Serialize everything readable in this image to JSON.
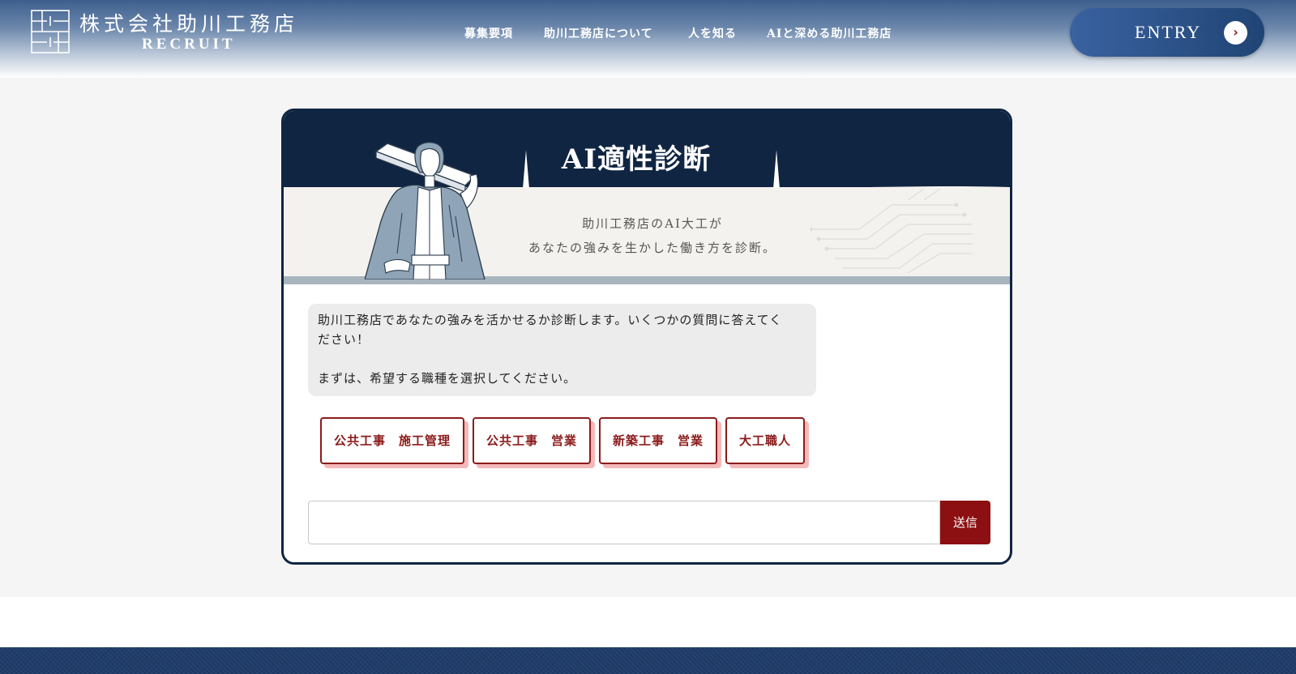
{
  "header": {
    "logo_name": "株式会社助川工務店",
    "logo_sub": "RECRUIT",
    "nav": [
      {
        "label": "募集要項"
      },
      {
        "label": "助川工務店について"
      },
      {
        "label": "人を知る"
      },
      {
        "label": "AIと深める助川工務店"
      }
    ],
    "entry_label": "ENTRY",
    "entry_icon": "chevron-right-icon"
  },
  "banner": {
    "title": "AI適性診断",
    "subtitle_line1": "助川工務店のAI大工が",
    "subtitle_line2": "あなたの強みを生かした働き方を診断。"
  },
  "chat": {
    "message_line1": "助川工務店であなたの強みを活かせるか診断します。いくつかの質問に答えてく",
    "message_line2": "ださい！",
    "message_line3": "まずは、希望する職種を選択してください。",
    "choices": [
      {
        "label": "公共工事　施工管理"
      },
      {
        "label": "公共工事　営業"
      },
      {
        "label": "新築工事　営業"
      },
      {
        "label": "大工職人"
      }
    ],
    "input_value": "",
    "send_label": "送信"
  },
  "colors": {
    "navy": "#0f2542",
    "accent_red": "#8c0f12",
    "choice_shadow": "#f3b9b9",
    "footer": "#1e3b69"
  }
}
